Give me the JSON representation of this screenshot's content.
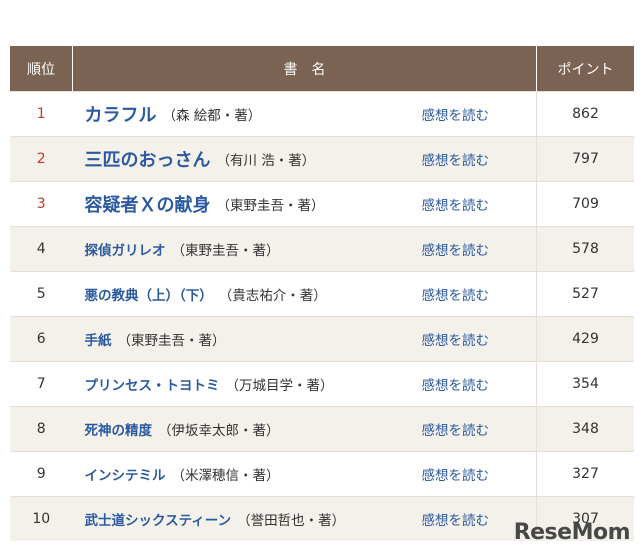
{
  "table": {
    "headers": {
      "rank": "順位",
      "title": "書　名",
      "points": "ポイント"
    },
    "review_label": "感想を読む",
    "rows": [
      {
        "rank": "1",
        "title": "カラフル",
        "author": "（森 絵都・著）",
        "points": "862"
      },
      {
        "rank": "2",
        "title": "三匹のおっさん",
        "author": "（有川 浩・著）",
        "points": "797"
      },
      {
        "rank": "3",
        "title": "容疑者Ｘの献身",
        "author": "（東野圭吾・著）",
        "points": "709"
      },
      {
        "rank": "4",
        "title": "探偵ガリレオ",
        "author": "（東野圭吾・著）",
        "points": "578"
      },
      {
        "rank": "5",
        "title": "悪の教典（上）（下）",
        "author": "（貴志祐介・著）",
        "points": "527"
      },
      {
        "rank": "6",
        "title": "手紙",
        "author": "（東野圭吾・著）",
        "points": "429"
      },
      {
        "rank": "7",
        "title": "プリンセス・トヨトミ",
        "author": "（万城目学・著）",
        "points": "354"
      },
      {
        "rank": "8",
        "title": "死神の精度",
        "author": "（伊坂幸太郎・著）",
        "points": "348"
      },
      {
        "rank": "9",
        "title": "インシテミル",
        "author": "（米澤穂信・著）",
        "points": "327"
      },
      {
        "rank": "10",
        "title": "武士道シックスティーン",
        "author": "（誉田哲也・著）",
        "points": "307"
      }
    ]
  },
  "watermark": "ReseMom"
}
